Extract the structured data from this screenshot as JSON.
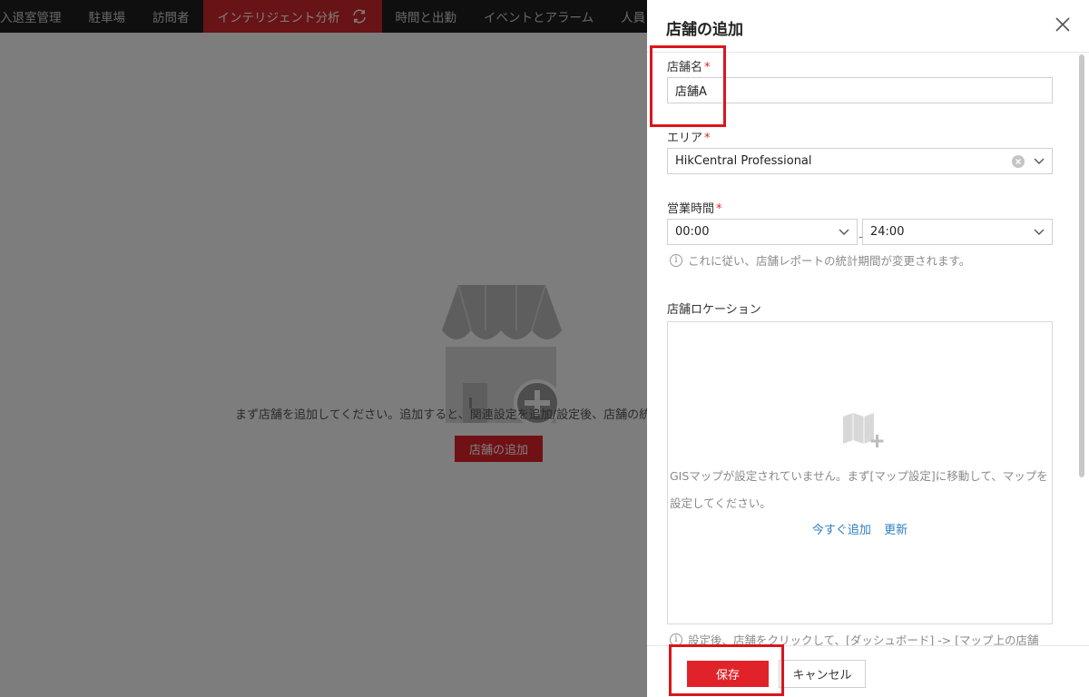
{
  "nav": {
    "items": [
      {
        "label": "入退室管理"
      },
      {
        "label": "駐車場"
      },
      {
        "label": "訪問者"
      },
      {
        "label": "インテリジェント分析",
        "active": true
      },
      {
        "label": "時間と出勤"
      },
      {
        "label": "イベントとアラーム"
      },
      {
        "label": "人員"
      }
    ],
    "active_color": "#d0262a"
  },
  "empty_state": {
    "message": "まず店舗を追加してください。追加すると、関連設定を追加/設定後、店舗の統",
    "add_button": "店舗の追加"
  },
  "drawer": {
    "title": "店舗の追加",
    "store_name": {
      "label": "店舗名",
      "required": "*",
      "value": "店舗A"
    },
    "area": {
      "label": "エリア",
      "required": "*",
      "value": "HikCentral Professional"
    },
    "business_hours": {
      "label": "営業時間",
      "required": "*",
      "start": "00:00",
      "separator": "-",
      "end": "24:00",
      "hint": "これに従い、店舗レポートの統計期間が変更されます。"
    },
    "location": {
      "label": "店舗ロケーション",
      "no_map_message": "GISマップが設定されていません。まず[マップ設定]に移動して、マップを設定してください。",
      "add_now_link": "今すぐ追加",
      "refresh_link": "更新",
      "hint": "設定後、店舗をクリックして、[ダッシュボード] -> [マップ上の店舗"
    },
    "save_button": "保存",
    "cancel_button": "キャンセル"
  },
  "colors": {
    "accent": "#e0232a",
    "link": "#2f7fc3",
    "callout": "#d9161c"
  }
}
